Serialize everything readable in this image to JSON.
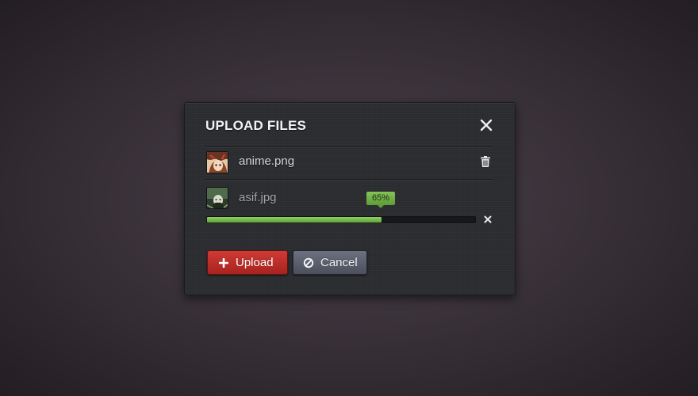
{
  "dialog": {
    "title": "UPLOAD FILES",
    "close_icon": "close-icon"
  },
  "files": [
    {
      "name": "anime.png",
      "thumbnail": "anime-thumbnail",
      "action_icon": "trash-icon",
      "state": "uploaded"
    },
    {
      "name": "asif.jpg",
      "thumbnail": "asif-thumbnail",
      "action_icon": "cancel-x-icon",
      "state": "uploading",
      "progress_label": "65%",
      "progress": 0.65
    }
  ],
  "buttons": {
    "upload_label": "Upload",
    "upload_icon": "plus-icon",
    "cancel_label": "Cancel",
    "cancel_icon": "ban-icon"
  },
  "colors": {
    "upload_button": "#b8302b",
    "cancel_button": "#5b606d",
    "progress_fill": "#7fbf4d",
    "progress_badge": "#75b54a",
    "dialog_bg": "#2b2d31"
  }
}
